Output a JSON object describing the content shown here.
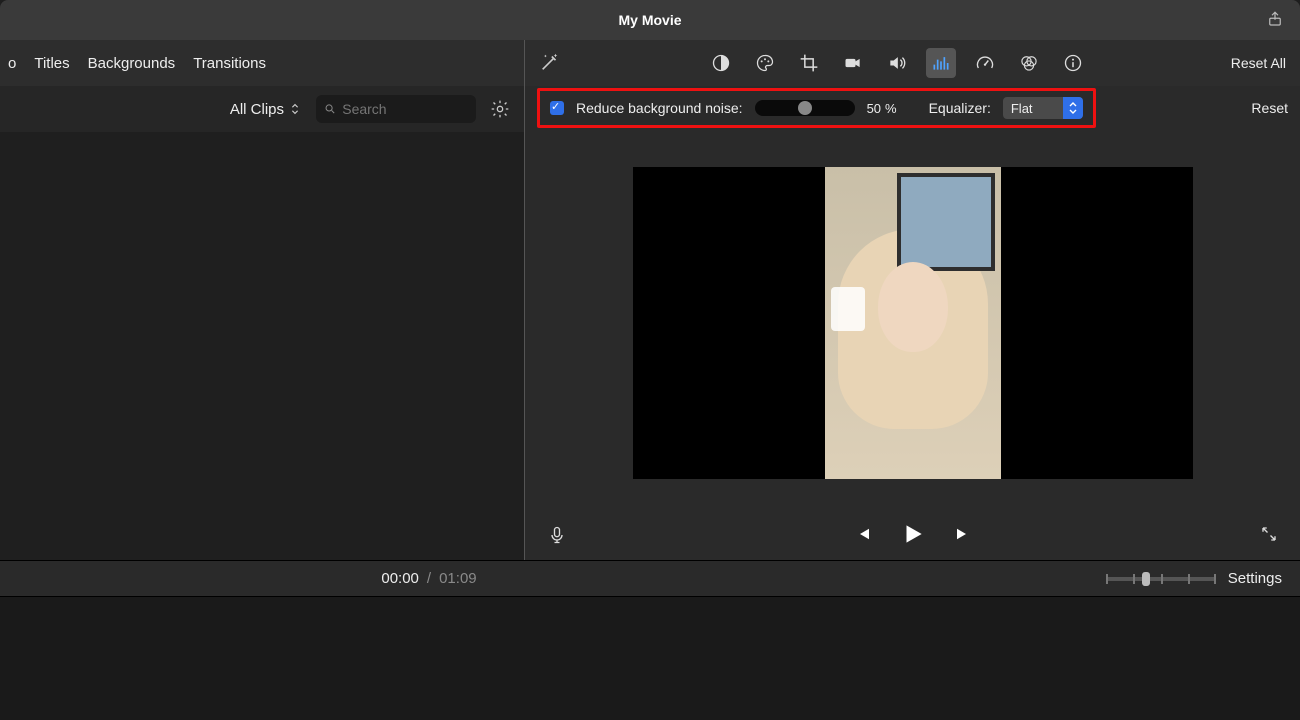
{
  "title": "My Movie",
  "tabs": {
    "audio": "o",
    "titles": "Titles",
    "backgrounds": "Backgrounds",
    "transitions": "Transitions"
  },
  "browser": {
    "filter": "All Clips",
    "search_placeholder": "Search"
  },
  "adjust": {
    "reset_all": "Reset All",
    "reduce_noise_label": "Reduce background noise:",
    "reduce_noise_checked": true,
    "reduce_noise_value": "50",
    "reduce_noise_unit": "%",
    "equalizer_label": "Equalizer:",
    "equalizer_value": "Flat",
    "reset": "Reset"
  },
  "playback": {
    "current": "00:00",
    "sep": "/",
    "duration": "01:09"
  },
  "footer": {
    "settings": "Settings"
  },
  "slider_percent": 50
}
